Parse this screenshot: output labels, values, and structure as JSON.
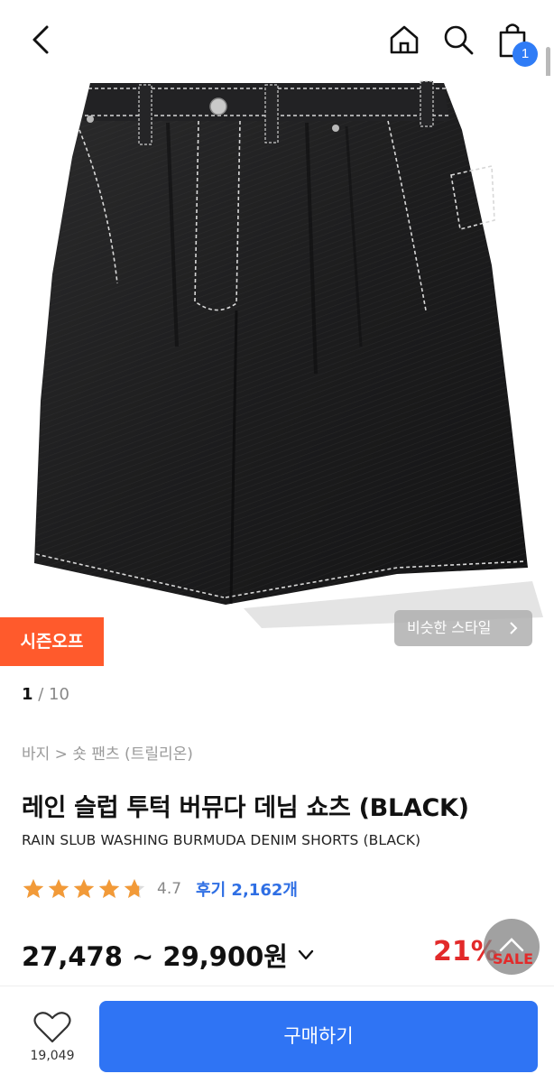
{
  "header": {
    "back_icon": "chevron-left-icon",
    "home_icon": "home-icon",
    "search_icon": "search-icon",
    "cart_icon": "shopping-bag-icon",
    "cart_badge": "1"
  },
  "gallery": {
    "season_badge": "시즌오프",
    "similar_style": "비슷한 스타일",
    "current_page": "1",
    "page_sep": " / ",
    "total_pages": "10"
  },
  "product": {
    "breadcrumb": "바지 > 숏 팬츠 (트릴리온)",
    "title": "레인 슬럽 투턱 버뮤다 데님 쇼츠 (BLACK)",
    "subtitle": "RAIN SLUB WASHING BURMUDA DENIM SHORTS (BLACK)",
    "rating_value": "4.7",
    "rating_stars": 4.7,
    "reviews": "후기 2,162개",
    "price_range": "27,478 ~ 29,900원",
    "discount": "21%",
    "sale_label": "SALE"
  },
  "bottom": {
    "wish_icon": "heart-icon",
    "wish_count": "19,049",
    "buy_label": "구매하기"
  },
  "colors": {
    "accent_blue": "#2f74f4",
    "season_orange": "#ff5a2c",
    "sale_red": "#e22a2a",
    "star_orange": "#f29a38"
  }
}
